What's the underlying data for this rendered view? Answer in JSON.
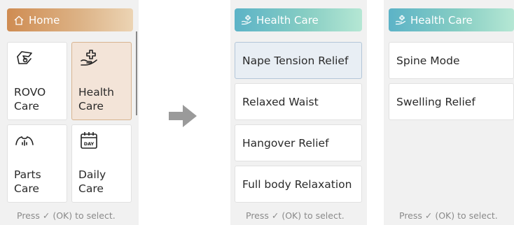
{
  "screen1": {
    "header": {
      "title": "Home",
      "icon": "home-icon"
    },
    "tiles": [
      {
        "label": "ROVO\nCare",
        "icon": "rovo-care-icon",
        "selected": false
      },
      {
        "label": "Health\nCare",
        "icon": "health-care-icon",
        "selected": true
      },
      {
        "label": "Parts\nCare",
        "icon": "parts-care-icon",
        "selected": false
      },
      {
        "label": "Daily\nCare",
        "icon": "calendar-day-icon",
        "selected": false
      }
    ],
    "calendar_icon_text": "DAY",
    "footer": "Press ✓ (OK) to select."
  },
  "arrow": {
    "icon": "arrow-right-icon"
  },
  "screen2": {
    "header": {
      "title": "Health Care",
      "icon": "health-care-icon"
    },
    "items": [
      {
        "label": "Nape Tension Relief",
        "selected": true
      },
      {
        "label": "Relaxed Waist",
        "selected": false
      },
      {
        "label": "Hangover Relief",
        "selected": false
      },
      {
        "label": "Full body Relaxation",
        "selected": false
      }
    ],
    "footer": "Press ✓ (OK) to select."
  },
  "screen3": {
    "header": {
      "title": "Health Care",
      "icon": "health-care-icon"
    },
    "items": [
      {
        "label": "Spine Mode",
        "selected": false
      },
      {
        "label": "Swelling Relief",
        "selected": false
      }
    ],
    "footer": "Press ✓ (OK) to select."
  },
  "colors": {
    "home_header": "#cf8c52",
    "health_header": "#5cb3c7",
    "selected_tile": "#f3e4d8",
    "selected_item": "#e8eef4",
    "arrow": "#9a9a9a"
  }
}
